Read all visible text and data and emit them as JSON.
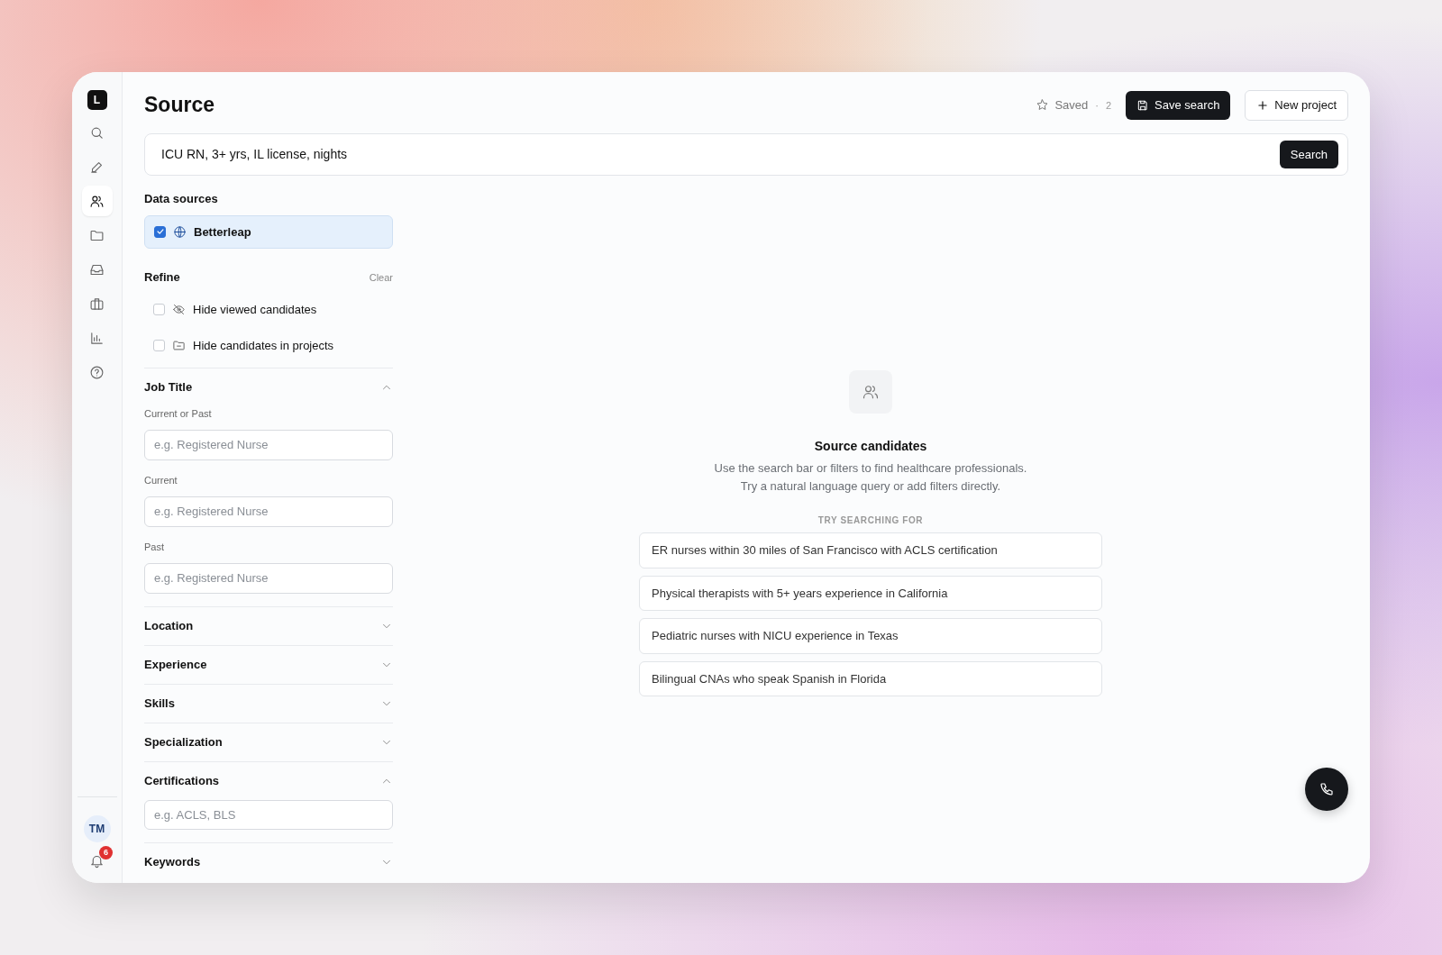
{
  "app": {
    "logo": "L"
  },
  "nav": [
    {
      "kind": "search",
      "selected": false
    },
    {
      "kind": "pen",
      "selected": false
    },
    {
      "kind": "people",
      "selected": true
    },
    {
      "kind": "folder",
      "selected": false
    },
    {
      "kind": "inbox",
      "selected": false
    },
    {
      "kind": "briefcase",
      "selected": false
    },
    {
      "kind": "chart",
      "selected": false
    },
    {
      "kind": "help",
      "selected": false
    }
  ],
  "user": {
    "initials": "TM"
  },
  "notifications": {
    "count": "6"
  },
  "page": {
    "title": "Source"
  },
  "saved": {
    "label": "Saved",
    "separator": "·",
    "count": "2"
  },
  "buttons": [
    {
      "kind": "save",
      "label": "Save search"
    },
    {
      "kind": "new",
      "label": "New project"
    }
  ],
  "search": {
    "value": "ICU RN, 3+ yrs, IL license, nights",
    "button": "Search"
  },
  "data_sources": {
    "title": "Data sources",
    "items": [
      {
        "label": "Betterleap",
        "checked": true
      }
    ]
  },
  "refine": {
    "title": "Refine",
    "clear": "Clear",
    "options": [
      {
        "kind": "eye-off",
        "label": "Hide viewed candidates",
        "checked": false
      },
      {
        "kind": "folder",
        "label": "Hide candidates in projects",
        "checked": false
      }
    ]
  },
  "filters": [
    {
      "title": "Job Title",
      "expanded": true,
      "fields": [
        {
          "label": "Current or Past",
          "placeholder": "e.g. Registered Nurse"
        },
        {
          "label": "Current",
          "placeholder": "e.g. Registered Nurse"
        },
        {
          "label": "Past",
          "placeholder": "e.g. Registered Nurse"
        }
      ]
    },
    {
      "title": "Location",
      "expanded": false
    },
    {
      "title": "Experience",
      "expanded": false
    },
    {
      "title": "Skills",
      "expanded": false
    },
    {
      "title": "Specialization",
      "expanded": false
    },
    {
      "title": "Certifications",
      "expanded": true,
      "fields": [
        {
          "placeholder": "e.g. ACLS, BLS"
        }
      ]
    },
    {
      "title": "Keywords",
      "expanded": false
    }
  ],
  "empty_state": {
    "title": "Source candidates",
    "lines": [
      "Use the search bar or filters to find healthcare professionals.",
      "Try a natural language query or add filters directly."
    ],
    "suggestions_title": "TRY SEARCHING FOR",
    "suggestions": [
      "ER nurses within 30 miles of San Francisco with ACLS certification",
      "Physical therapists with 5+ years experience in California",
      "Pediatric nurses with NICU experience in Texas",
      "Bilingual CNAs who speak Spanish in Florida"
    ]
  }
}
